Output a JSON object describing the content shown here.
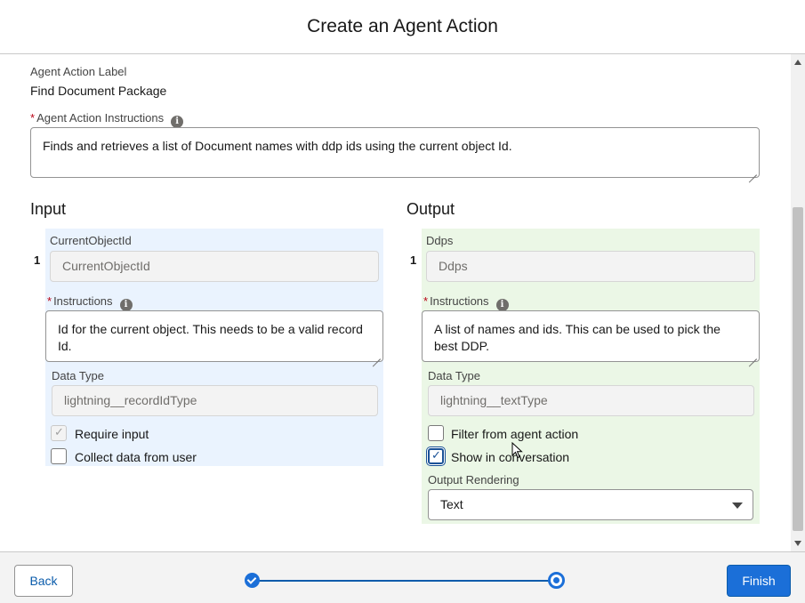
{
  "modal": {
    "title": "Create an Agent Action"
  },
  "action_label": {
    "label": "Agent Action Label",
    "value": "Find Document Package"
  },
  "action_instructions": {
    "required_marker": "*",
    "label": "Agent Action Instructions",
    "info_icon": "i",
    "value": "Finds and retrieves a list of Document names with ddp ids using the current object Id."
  },
  "input": {
    "title": "Input",
    "row_number": "1",
    "param_label": "CurrentObjectId",
    "param_value": "CurrentObjectId",
    "instructions_label": "Instructions",
    "instructions_value": "Id for the current object.  This needs to be a valid record Id.",
    "data_type_label": "Data Type",
    "data_type_value": "lightning__recordIdType",
    "require_input_label": "Require input",
    "collect_data_label": "Collect data from user"
  },
  "output": {
    "title": "Output",
    "row_number": "1",
    "param_label": "Ddps",
    "param_value": "Ddps",
    "instructions_label": "Instructions",
    "instructions_value": "A list of names and ids. This can be used to pick the best DDP.",
    "data_type_label": "Data Type",
    "data_type_value": "lightning__textType",
    "filter_label": "Filter from agent action",
    "show_label": "Show in conversation",
    "rendering_label": "Output Rendering",
    "rendering_value": "Text"
  },
  "footer": {
    "back_label": "Back",
    "finish_label": "Finish"
  },
  "colors": {
    "brand": "#1b6fd8",
    "input_panel": "#eaf3fe",
    "output_panel": "#ebf7e6"
  }
}
